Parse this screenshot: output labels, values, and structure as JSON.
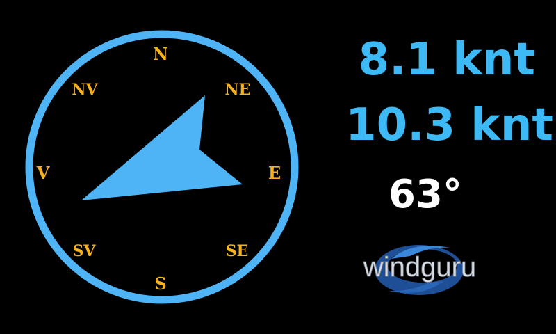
{
  "colors": {
    "background": "#000000",
    "accent_blue": "#4fb4f5",
    "speed_text": "#3db9f5",
    "direction_text": "#ffffff",
    "compass_letters": "#f5b21e",
    "logo_swoosh": "#2a66b8",
    "logo_text": "#d8dde3"
  },
  "compass": {
    "labels": {
      "n": "N",
      "ne": "NE",
      "e": "E",
      "se": "SE",
      "s": "S",
      "sv": "SV",
      "v": "V",
      "nv": "NV"
    },
    "arrow_bearing_deg": 63
  },
  "readouts": {
    "wind_speed": "8.1 knt",
    "wind_gust": "10.3 knt",
    "wind_direction": "63°"
  },
  "logo": {
    "text": "windguru",
    "icon": "windguru-swirl-logo"
  }
}
